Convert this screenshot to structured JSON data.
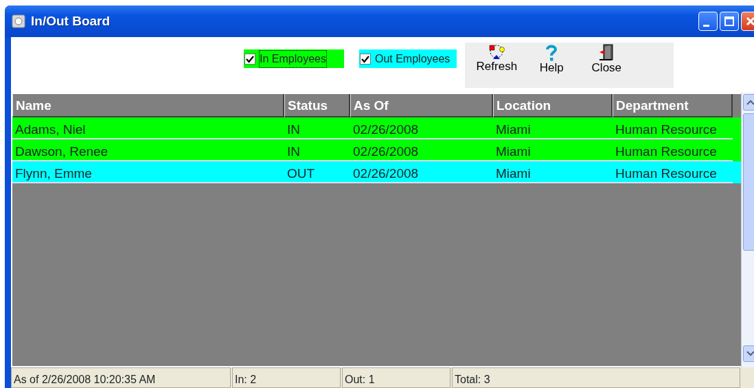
{
  "window": {
    "title": "In/Out Board"
  },
  "filters": [
    {
      "label": "In Employees",
      "checked": true,
      "color": "#00ff00",
      "focused": true
    },
    {
      "label": "Out Employees",
      "checked": true,
      "color": "#00ffff",
      "focused": false
    }
  ],
  "toolbar": [
    {
      "label": "Refresh",
      "kind": "refresh"
    },
    {
      "label": "Help",
      "kind": "help"
    },
    {
      "label": "Close",
      "kind": "close"
    }
  ],
  "table": {
    "columns": [
      "Name",
      "Status",
      "As Of",
      "Location",
      "Department"
    ],
    "rows": [
      {
        "color": "#00ff00",
        "cells": [
          "Adams, Niel",
          "IN",
          "02/26/2008",
          "Miami",
          "Human Resource"
        ]
      },
      {
        "color": "#00ff00",
        "cells": [
          "Dawson, Renee",
          "IN",
          "02/26/2008",
          "Miami",
          "Human Resource"
        ]
      },
      {
        "color": "#00ffff",
        "cells": [
          "Flynn, Emme",
          "OUT",
          "02/26/2008",
          "Miami",
          "Human Resource"
        ]
      }
    ]
  },
  "status_bar": [
    "As of 2/26/2008 10:20:35 AM",
    "In: 2",
    "Out: 1",
    "Total: 3"
  ]
}
